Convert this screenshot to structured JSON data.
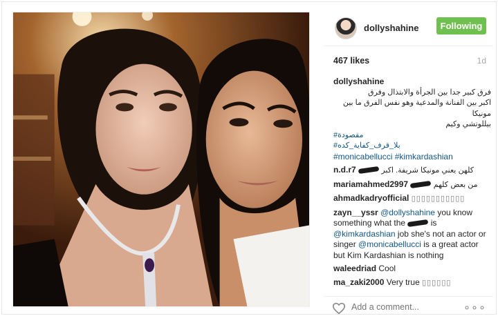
{
  "post": {
    "username": "dollyshahine",
    "follow_label": "Following",
    "likes": "467 likes",
    "age": "1d"
  },
  "caption": {
    "username": "dollyshahine",
    "line1": "فرق كبير جدا بين الجرأة والابتذال وفرق",
    "line2": "اكبر بين الفنانة والمدعية وهو نفس الفرق ما بين مونيكا",
    "line3": "بيللوتشي وكيم",
    "hashtag1": "#مقصودة",
    "hashtag2": "#بلا_قرف_كفاية_كده",
    "hashtag3": "#monicabellucci #kimkardashian"
  },
  "comments": [
    {
      "user": "n.d.r7",
      "text_a": "يعني مونيكا شريفة. اكبر",
      "text_b": "كلهن"
    },
    {
      "user": "mariamahmed2997",
      "text_a": "كلهم",
      "text_b": "من بعض"
    },
    {
      "user": "ahmadkadryofficial",
      "text": "▯▯▯▯▯▯▯▯▯▯▯"
    },
    {
      "user": "zayn__yssr",
      "mention1": "@dollyshahine",
      "text1": "you know something what the",
      "text2": "is",
      "mention2": "@kimkardashian",
      "text3": "job she's not an actor or singer",
      "mention3": "@monicabellucci",
      "text4": "is a great actor but Kim Kardashian is nothing"
    },
    {
      "user": "waleedriad",
      "text": "Cool"
    },
    {
      "user": "ma_zaki2000",
      "text": "Very true",
      "suffix": "▯▯▯▯▯▯"
    }
  ],
  "footer": {
    "add_comment_placeholder": "Add a comment...",
    "more": "∘∘∘"
  },
  "icons": {
    "heart": "heart-icon",
    "more": "more-options-icon"
  },
  "colors": {
    "follow_green": "#70c050",
    "link_blue": "#125688"
  }
}
